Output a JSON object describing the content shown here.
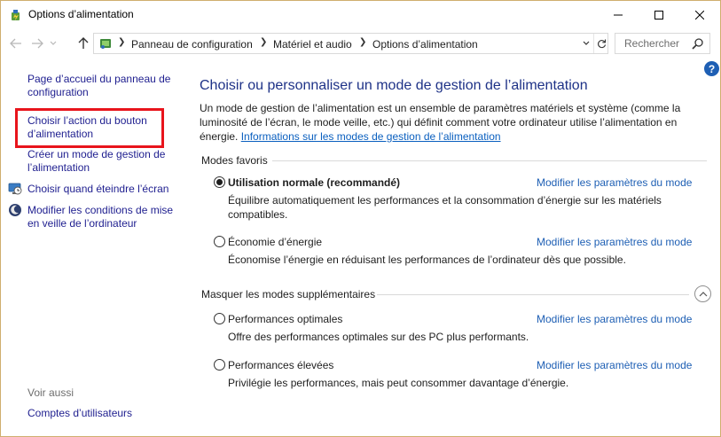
{
  "window": {
    "title": "Options d’alimentation"
  },
  "nav": {
    "breadcrumbs": [
      "Panneau de configuration",
      "Matériel et audio",
      "Options d’alimentation"
    ],
    "search_placeholder": "Rechercher",
    "help_label": "?"
  },
  "sidebar": {
    "home": "Page d’accueil du panneau de configuration",
    "items": [
      {
        "label": "Choisir l’action du bouton d’alimentation",
        "highlighted": true
      },
      {
        "label": "Créer un mode de gestion de l’alimentation"
      },
      {
        "label": "Choisir quand éteindre l’écran",
        "icon": "monitor-clock-icon"
      },
      {
        "label": "Modifier les conditions de mise en veille de l’ordinateur",
        "icon": "moon-icon"
      }
    ],
    "see_also": "Voir aussi",
    "see_also_items": [
      "Comptes d’utilisateurs"
    ]
  },
  "main": {
    "title": "Choisir ou personnaliser un mode de gestion de l’alimentation",
    "intro": "Un mode de gestion de l’alimentation est un ensemble de paramètres matériels et système (comme la luminosité de l’écran, le mode veille, etc.) qui définit comment votre ordinateur utilise l’alimentation en énergie.",
    "intro_link": "Informations sur les modes de gestion de l’alimentation",
    "favorites_header": "Modes favoris",
    "hidden_header": "Masquer les modes supplémentaires",
    "change_link": "Modifier les paramètres du mode",
    "plans": [
      {
        "name": "Utilisation normale (recommandé)",
        "selected": true,
        "description": "Équilibre automatiquement les performances et la consommation d’énergie sur les matériels compatibles."
      },
      {
        "name": "Économie d’énergie",
        "selected": false,
        "description": "Économise l’énergie en réduisant les performances de l’ordinateur dès que possible."
      },
      {
        "name": "Performances optimales",
        "selected": false,
        "description": "Offre des performances optimales sur des PC plus performants."
      },
      {
        "name": "Performances élevées",
        "selected": false,
        "description": "Privilégie les performances, mais peut consommer davantage d’énergie."
      }
    ]
  },
  "colors": {
    "highlight_box": "#e8141c",
    "title_blue": "#1e3287",
    "link_blue": "#1e5fb4",
    "window_border": "#cfae6e"
  }
}
